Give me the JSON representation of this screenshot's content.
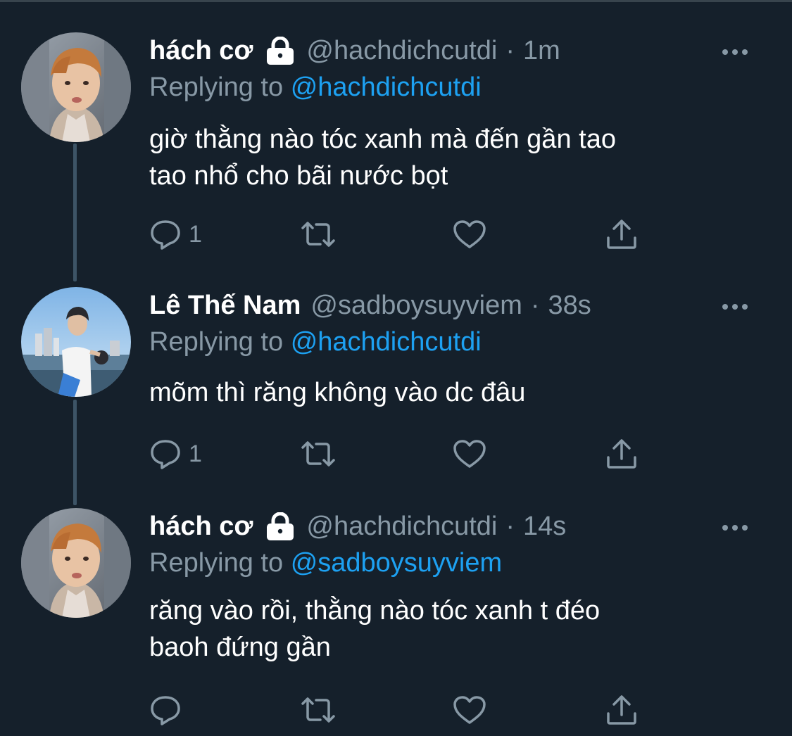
{
  "colors": {
    "background": "#15202b",
    "primary_text": "#ffffff",
    "secondary_text": "#8899a6",
    "accent": "#1da1f2",
    "thread_line": "#3d5466"
  },
  "tweets": [
    {
      "display_name": "hách cơ",
      "protected": true,
      "handle": "@hachdichcutdi",
      "dot": "·",
      "time": "1m",
      "replying_prefix": "Replying to",
      "replying_to": "@hachdichcutdi",
      "text_lines": [
        "giờ thằng nào tóc xanh mà đến gần tao",
        "tao nhổ cho bãi nước bọt"
      ],
      "reply_count": "1",
      "avatar_icon": "avatar-photo"
    },
    {
      "display_name": "Lê Thế Nam",
      "protected": false,
      "handle": "@sadboysuyviem",
      "dot": "·",
      "time": "38s",
      "replying_prefix": "Replying to",
      "replying_to": "@hachdichcutdi",
      "text_lines": [
        "mõm thì răng không vào dc đâu"
      ],
      "reply_count": "1",
      "avatar_icon": "avatar-photo"
    },
    {
      "display_name": "hách cơ",
      "protected": true,
      "handle": "@hachdichcutdi",
      "dot": "·",
      "time": "14s",
      "replying_prefix": "Replying to",
      "replying_to": "@sadboysuyviem",
      "text_lines": [
        "răng vào rồi, thằng nào tóc xanh t đéo",
        "baoh đứng gần"
      ],
      "reply_count": "",
      "avatar_icon": "avatar-photo"
    }
  ],
  "icons": {
    "reply": "reply-icon",
    "retweet": "retweet-icon",
    "like": "like-icon",
    "share": "share-icon",
    "more": "more-icon",
    "lock": "lock-icon"
  }
}
